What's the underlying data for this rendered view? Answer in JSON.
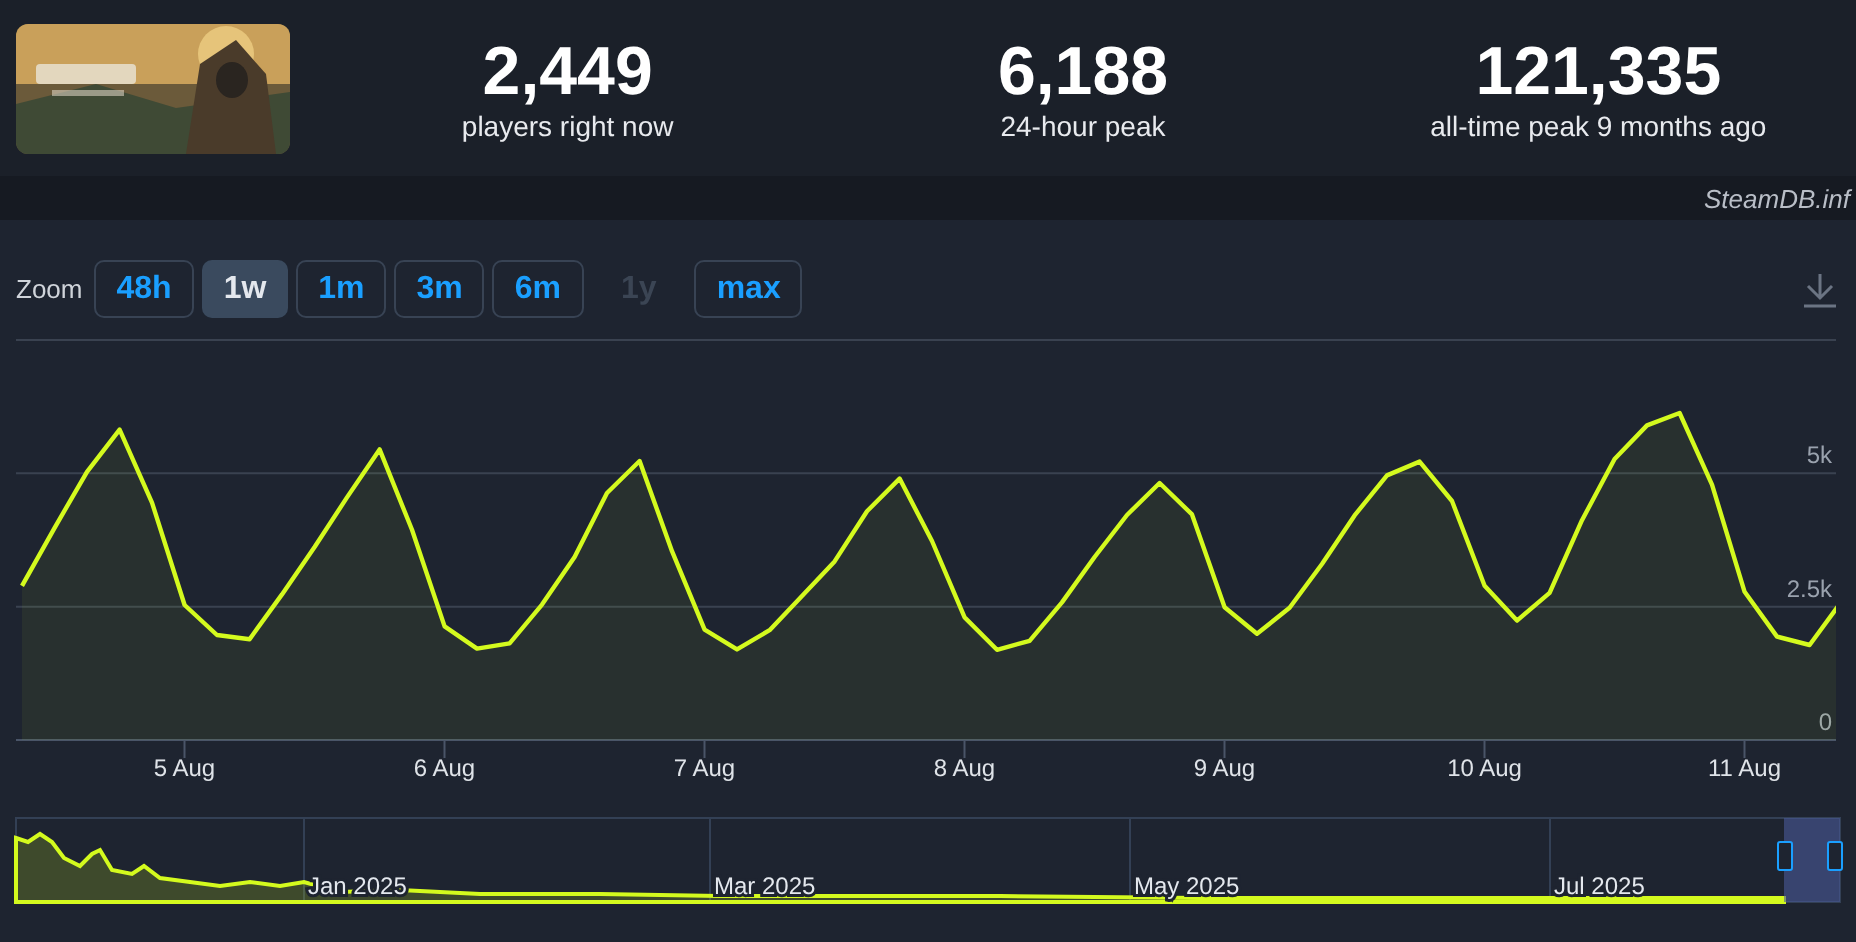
{
  "header": {
    "stats": [
      {
        "value": "2,449",
        "label": "players right now"
      },
      {
        "value": "6,188",
        "label": "24-hour peak"
      },
      {
        "value": "121,335",
        "label": "all-time peak 9 months ago"
      }
    ],
    "credit": "SteamDB.inf"
  },
  "zoom": {
    "label": "Zoom",
    "buttons": [
      {
        "label": "48h",
        "selected": false,
        "disabled": false
      },
      {
        "label": "1w",
        "selected": true,
        "disabled": false
      },
      {
        "label": "1m",
        "selected": false,
        "disabled": false
      },
      {
        "label": "3m",
        "selected": false,
        "disabled": false
      },
      {
        "label": "6m",
        "selected": false,
        "disabled": false
      },
      {
        "label": "1y",
        "selected": false,
        "disabled": true
      },
      {
        "label": "max",
        "selected": false,
        "disabled": false
      }
    ]
  },
  "chart": {
    "chart_data": {
      "type": "area",
      "ylim": [
        0,
        7500
      ],
      "yticks": [
        {
          "value": 0,
          "label": "0"
        },
        {
          "value": 2500,
          "label": "2.5k"
        },
        {
          "value": 5000,
          "label": "5k"
        }
      ],
      "categories": [
        null,
        null,
        null,
        null,
        null,
        "5 Aug",
        null,
        null,
        null,
        null,
        null,
        null,
        null,
        "6 Aug",
        null,
        null,
        null,
        null,
        null,
        null,
        null,
        "7 Aug",
        null,
        null,
        null,
        null,
        null,
        null,
        null,
        "8 Aug",
        null,
        null,
        null,
        null,
        null,
        null,
        null,
        "9 Aug",
        null,
        null,
        null,
        null,
        null,
        null,
        null,
        "10 Aug",
        null,
        null,
        null,
        null,
        null,
        null,
        null,
        "11 Aug",
        null,
        null,
        null
      ],
      "series": [
        {
          "color": "#d4fa1e",
          "values": [
            2890,
            3980,
            5030,
            5820,
            4450,
            2530,
            1970,
            1890,
            2730,
            3620,
            4550,
            5450,
            3940,
            2130,
            1715,
            1810,
            2540,
            3430,
            4630,
            5230,
            3540,
            2070,
            1700,
            2060,
            2700,
            3350,
            4290,
            4900,
            3730,
            2300,
            1690,
            1860,
            2580,
            3430,
            4220,
            4820,
            4230,
            2490,
            1990,
            2480,
            3300,
            4210,
            4960,
            5220,
            4480,
            2890,
            2240,
            2760,
            4120,
            5270,
            5900,
            6130,
            4790,
            2780,
            1940,
            1780,
            2610
          ]
        }
      ]
    }
  },
  "navigator": {
    "labels": [
      "Jan 2025",
      "Mar 2025",
      "May 2025",
      "Jul 2025"
    ]
  }
}
